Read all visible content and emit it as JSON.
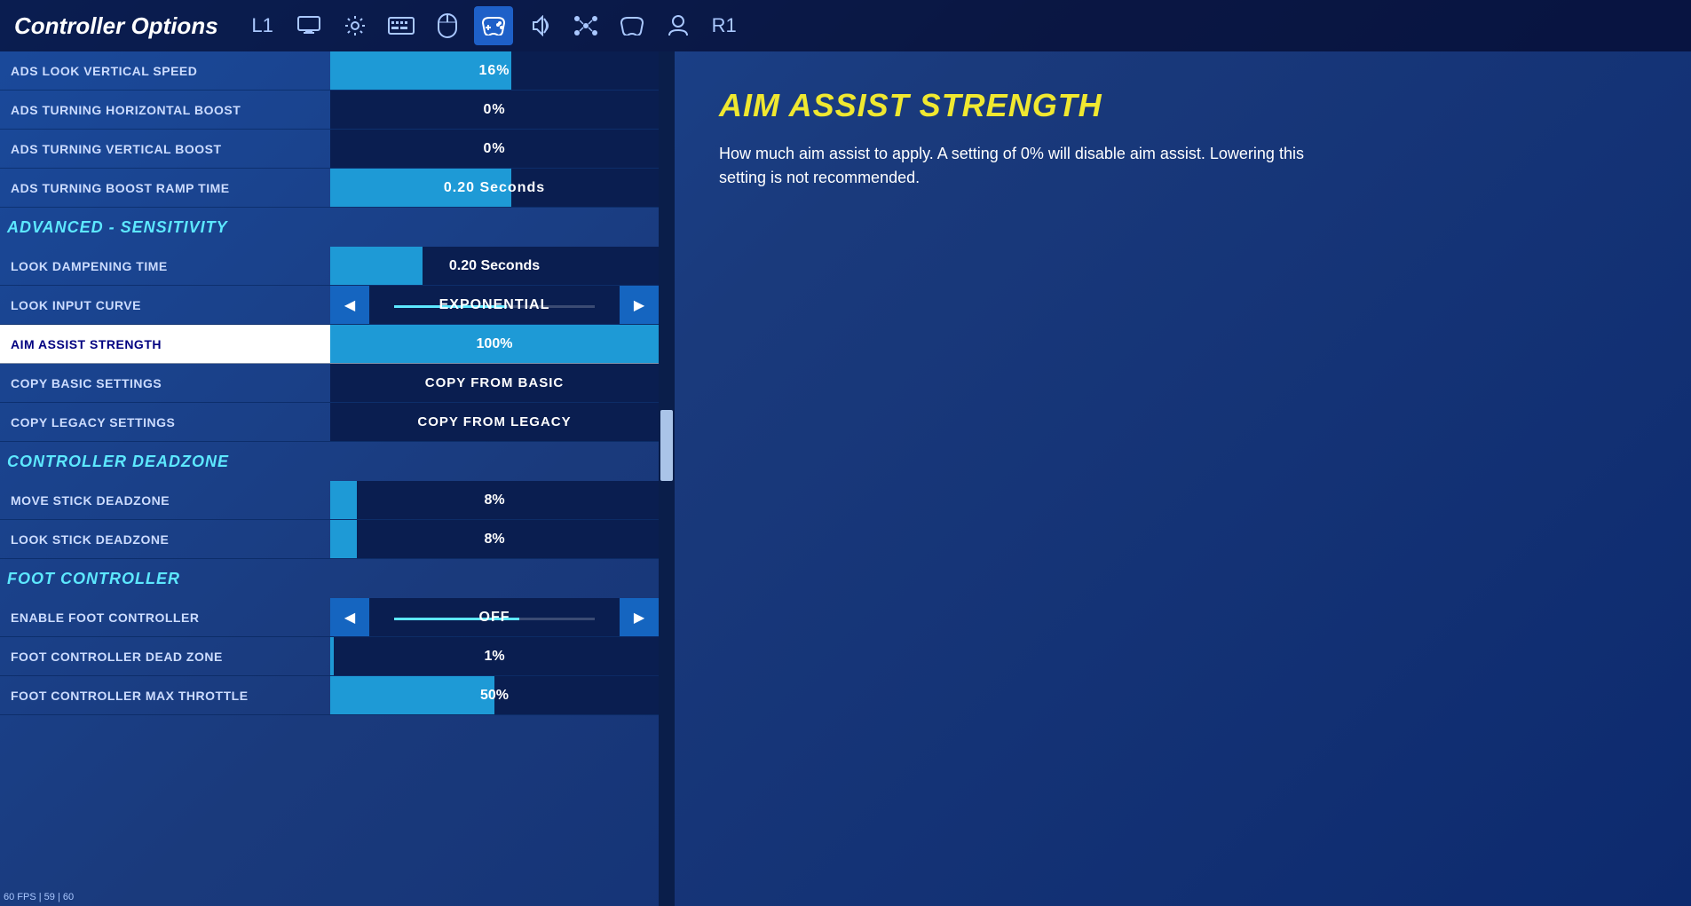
{
  "header": {
    "title": "Controller Options",
    "nav_icons": [
      "L1",
      "🖥",
      "⚙",
      "📋",
      "⌨",
      "🎮",
      "🔊",
      "⬡",
      "🎮",
      "👤",
      "R1"
    ]
  },
  "right_panel": {
    "title": "AIM ASSIST STRENGTH",
    "description": "How much aim assist to apply.  A setting of 0% will disable aim assist.  Lowering this setting is not recommended."
  },
  "settings": {
    "rows": [
      {
        "id": "ads-look-vertical-speed",
        "label": "ADS LOOK VERTICAL SPEED",
        "value": "16%",
        "type": "slider",
        "fill": "partial-fill-16"
      },
      {
        "id": "ads-turning-horizontal-boost",
        "label": "ADS TURNING HORIZONTAL BOOST",
        "value": "0%",
        "type": "plain"
      },
      {
        "id": "ads-turning-vertical-boost",
        "label": "ADS TURNING VERTICAL BOOST",
        "value": "0%",
        "type": "plain"
      },
      {
        "id": "ads-turning-boost-ramp-time",
        "label": "ADS TURNING BOOST RAMP TIME",
        "value": "0.20 Seconds",
        "type": "slider",
        "fill": "partial-fill-20"
      }
    ],
    "section_advanced": "ADVANCED - SENSITIVITY",
    "advanced_rows": [
      {
        "id": "look-dampening-time",
        "label": "LOOK DAMPENING TIME",
        "value": "0.20 Seconds",
        "type": "slider",
        "fill": "partial-fill-20"
      },
      {
        "id": "look-input-curve",
        "label": "LOOK INPUT CURVE",
        "value": "EXPONENTIAL",
        "type": "arrow"
      },
      {
        "id": "aim-assist-strength",
        "label": "AIM ASSIST STRENGTH",
        "value": "100%",
        "type": "full",
        "selected": true
      },
      {
        "id": "copy-basic-settings",
        "label": "COPY BASIC SETTINGS",
        "value": "COPY FROM BASIC",
        "type": "button"
      },
      {
        "id": "copy-legacy-settings",
        "label": "COPY LEGACY SETTINGS",
        "value": "COPY FROM LEGACY",
        "type": "button"
      }
    ],
    "section_deadzone": "CONTROLLER DEADZONE",
    "deadzone_rows": [
      {
        "id": "move-stick-deadzone",
        "label": "MOVE STICK DEADZONE",
        "value": "8%",
        "type": "slider",
        "fill": "partial-fill-8"
      },
      {
        "id": "look-stick-deadzone",
        "label": "LOOK STICK DEADZONE",
        "value": "8%",
        "type": "slider",
        "fill": "partial-fill-8"
      }
    ],
    "section_foot": "FOOT CONTROLLER",
    "foot_rows": [
      {
        "id": "enable-foot-controller",
        "label": "ENABLE FOOT CONTROLLER",
        "value": "OFF",
        "type": "arrow"
      },
      {
        "id": "foot-controller-dead-zone",
        "label": "FOOT CONTROLLER DEAD ZONE",
        "value": "1%",
        "type": "slider",
        "fill": "partial-fill-1"
      },
      {
        "id": "foot-controller-max-throttle",
        "label": "FOOT CONTROLLER MAX THROTTLE",
        "value": "50%",
        "type": "slider",
        "fill": "partial-fill-50"
      }
    ]
  },
  "fps": "60 FPS | 59 | 60"
}
